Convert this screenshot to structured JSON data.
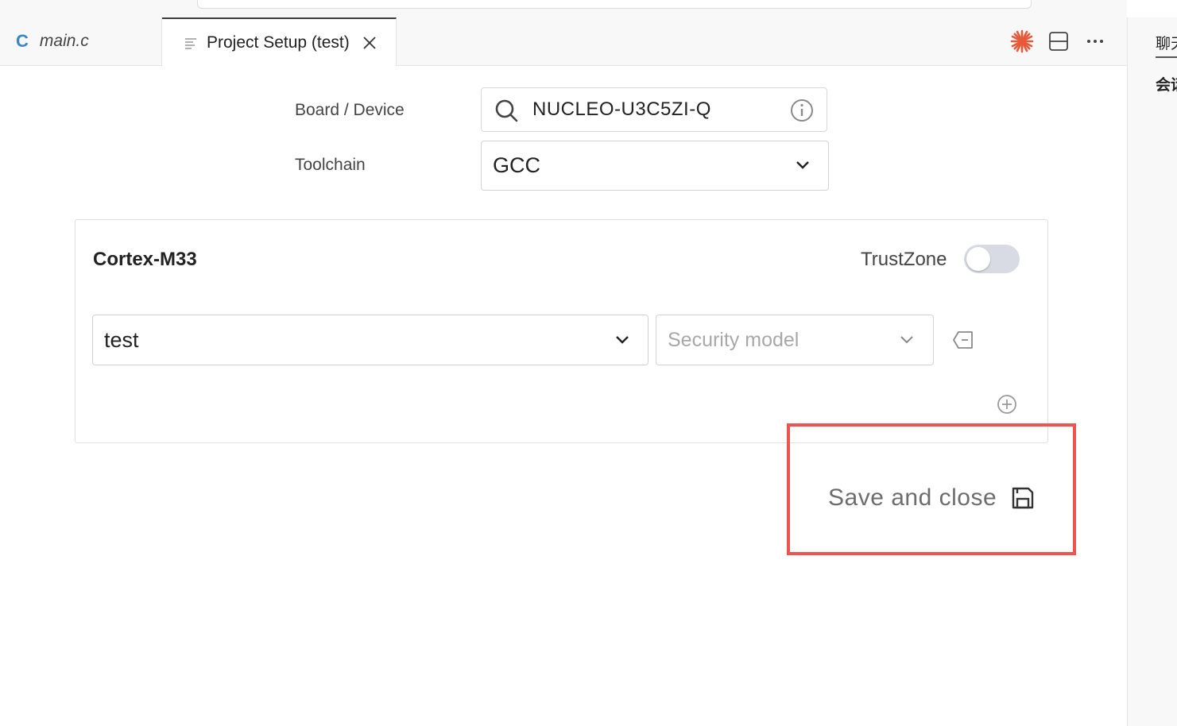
{
  "tabs": {
    "main_file": {
      "icon_letter": "C",
      "label": "main.c"
    },
    "setup": {
      "label": "Project Setup (test)"
    }
  },
  "sidebar_right": {
    "item1": "聊天",
    "item2": "会话"
  },
  "form": {
    "board_label": "Board / Device",
    "board_value": "NUCLEO-U3C5ZI-Q",
    "toolchain_label": "Toolchain",
    "toolchain_value": "GCC"
  },
  "core_card": {
    "core_name": "Cortex-M33",
    "trustzone_label": "TrustZone",
    "trustzone_enabled": false,
    "project_value": "test",
    "security_placeholder": "Security model"
  },
  "save_button": {
    "label": "Save and close"
  },
  "colors": {
    "accent_icon": "#e8593a",
    "highlight": "#ef5350",
    "c_icon": "#3b86c8"
  }
}
